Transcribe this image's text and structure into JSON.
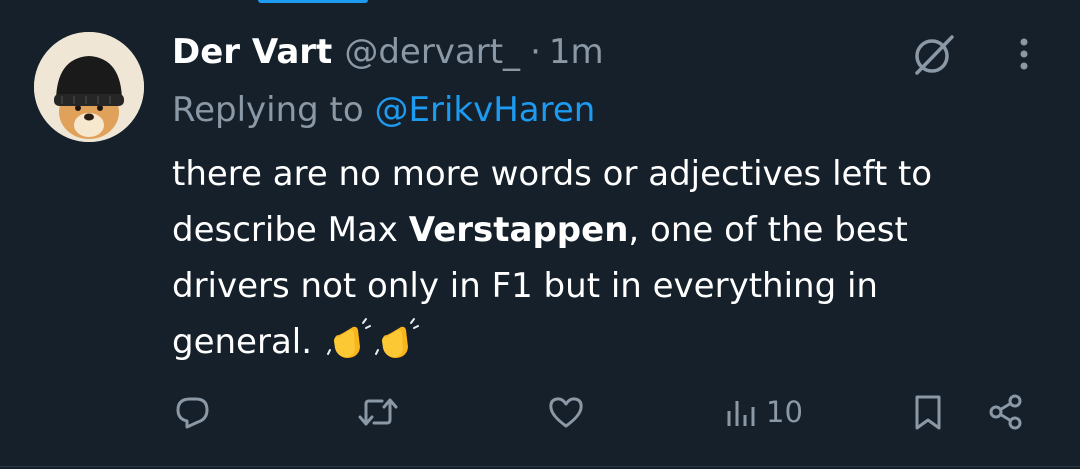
{
  "tweet": {
    "display_name": "Der Vart",
    "handle": "@dervart_",
    "separator": "·",
    "time": "1m",
    "replying_prefix": "Replying to",
    "replying_to": "@ErikvHaren",
    "text_line1": "there are no more words or adjectives left to",
    "text_line2_pre": "describe Max ",
    "text_line2_bold": "Verstappen",
    "text_line2_post": ", one of the best",
    "text_line3": "drivers not only in F1 but in everything in",
    "text_line4": "general."
  },
  "actions": {
    "views": "10"
  },
  "icons": {
    "reply": "reply-icon",
    "retweet": "retweet-icon",
    "like": "like-icon",
    "views": "views-icon",
    "bookmark": "bookmark-icon",
    "share": "share-icon",
    "grok": "grok-icon",
    "more": "more-icon",
    "clap": "clapping-hands-emoji"
  },
  "colors": {
    "background": "#15202b",
    "text": "#ffffff",
    "secondary": "#8b98a5",
    "accent": "#1d9bf0"
  }
}
